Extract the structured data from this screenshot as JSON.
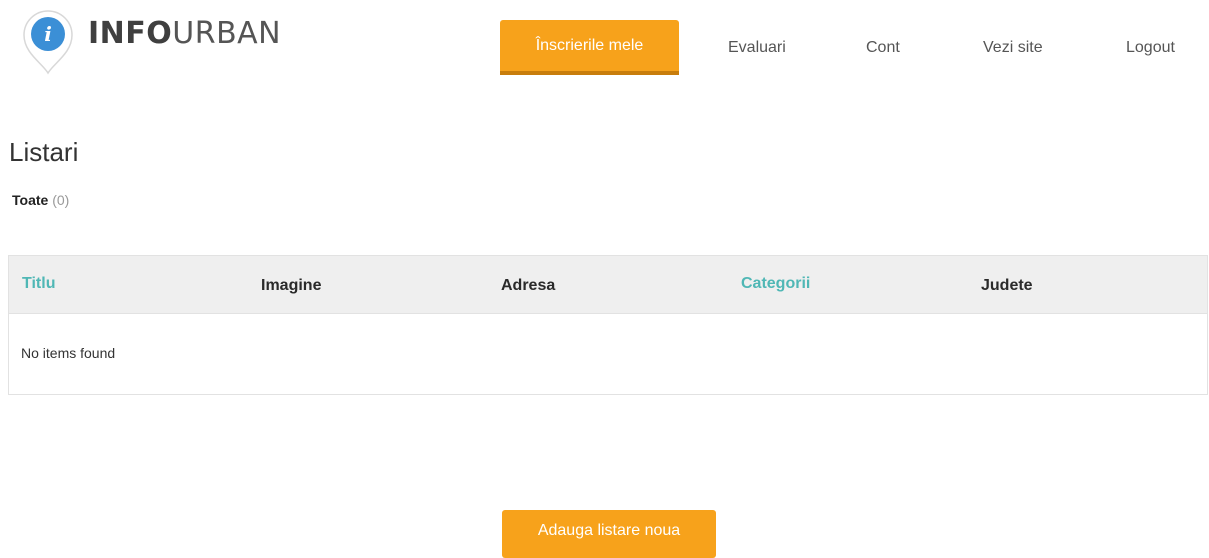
{
  "brand": {
    "name_bold": "INFO",
    "name_light": "URBAN",
    "icon": "info-pin-icon",
    "icon_glyph": "i",
    "color_pin": "#3b8fd6"
  },
  "nav": {
    "active_label": "Înscrierile mele",
    "items": [
      {
        "label": "Evaluari"
      },
      {
        "label": "Cont"
      },
      {
        "label": "Vezi site"
      },
      {
        "label": "Logout"
      }
    ]
  },
  "colors": {
    "accent": "#f7a21b",
    "link": "#4fb7b5"
  },
  "page": {
    "title": "Listari",
    "filter_label": "Toate",
    "filter_count": "(0)"
  },
  "table": {
    "columns": [
      {
        "label": "Titlu",
        "sortable": true
      },
      {
        "label": "Imagine",
        "sortable": false
      },
      {
        "label": "Adresa",
        "sortable": false
      },
      {
        "label": "Categorii",
        "sortable": true
      },
      {
        "label": "Judete",
        "sortable": false
      }
    ],
    "empty_message": "No items found"
  },
  "actions": {
    "add_label": "Adauga listare noua"
  }
}
